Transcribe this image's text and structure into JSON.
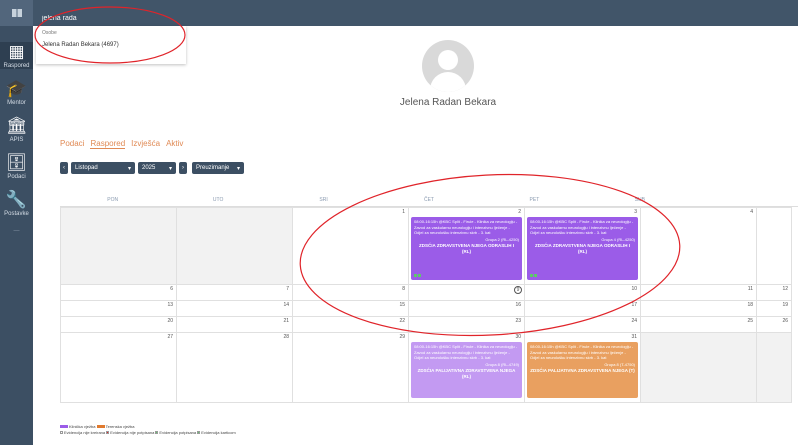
{
  "search": {
    "value": "jelena rada"
  },
  "dropdown": {
    "header": "Osobe",
    "item": "Jelena Radan Bekara (4697)"
  },
  "sidebar": {
    "items": [
      {
        "label": "Raspored"
      },
      {
        "label": "Mentor"
      },
      {
        "label": "APIS"
      },
      {
        "label": "Podaci"
      },
      {
        "label": "Postavke"
      },
      {
        "label": "—"
      }
    ]
  },
  "profile": {
    "name": "Jelena Radan Bekara"
  },
  "tabs": [
    {
      "label": "Podaci"
    },
    {
      "label": "Raspored"
    },
    {
      "label": "Izvješća"
    },
    {
      "label": "Aktiv"
    }
  ],
  "controls": {
    "month": "Listopad",
    "year": "2025",
    "view": "Preuzimanje"
  },
  "calendar": {
    "days": [
      "PON",
      "UTO",
      "SRI",
      "ČET",
      "PET",
      "SUB",
      ""
    ],
    "weeks": [
      [
        "",
        "",
        "1",
        "2",
        "3",
        "4",
        ""
      ],
      [
        "6",
        "7",
        "8",
        "9",
        "10",
        "11",
        "12"
      ],
      [
        "13",
        "14",
        "15",
        "16",
        "17",
        "18",
        "19"
      ],
      [
        "20",
        "21",
        "22",
        "23",
        "24",
        "25",
        "26"
      ],
      [
        "27",
        "28",
        "29",
        "30",
        "31",
        "",
        ""
      ]
    ],
    "events": [
      {
        "text": "08:00-16:15h @KBC Split - Firule - Klinika za neurologiju - Zavod za vaskularnu neurologiju i intenzivnu lječenje - Odjel za neurološku intenzivnu skrb - 3. kat",
        "group": "Grupa 2 (RL-4250)",
        "title": "ZDSĆIA ZDRAVSTVENA NJEGA ODRASLIH I (RL)"
      },
      {
        "text": "08:00-16:15h @KBC Split - Firule - Klinika za neurologiju - Zavod za vaskularnu neurologiju i intenzivnu lječenje - Odjel za neurološku intenzivnu skrb - 3. kat",
        "group": "Grupa 4 (RL-4250)",
        "title": "ZDSĆIA ZDRAVSTVENA NJEGA ODRASLIH I (RL)"
      },
      {
        "text": "08:00-16:15h @KBC Split - Firule - Klinika za neurologiju - Zavod za vaskularnu neurologiju i intenzivnu lječenje - Odjel za neurološku intenzivnu skrb - 3. kat",
        "group": "Grupa 8 (RL-4749)",
        "title": "ZDSĆIA PALIJATIVNA ZDRAVSTVENA NJEGA (RL)"
      },
      {
        "text": "08:00-16:15h @KBC Split - Firule - Klinika za neurologiju - Zavod za vaskularnu neurologiju i intenzivnu lječenje - Odjel za neurološku intenzivnu skrb - 3. kat",
        "group": "Grupa 8 (T-4750)",
        "title": "ZDSĆIA PALIJATIVNA ZDRAVSTVENA NJEGA (T)"
      }
    ]
  },
  "legend": {
    "line1": [
      "Klinička vježba",
      "Terenska vježba"
    ],
    "line2": [
      "Evidencija nije kreirana",
      "Evidencija nije potpisana",
      "Evidencija potpisana",
      "Evidencija karticom"
    ]
  },
  "colors": {
    "purple": "#9b5ce8",
    "light_purple": "#c39af2",
    "orange": "#e9a060",
    "sidebar": "#3c4f63",
    "accent": "#e08a55",
    "annotation": "#e0242a"
  }
}
